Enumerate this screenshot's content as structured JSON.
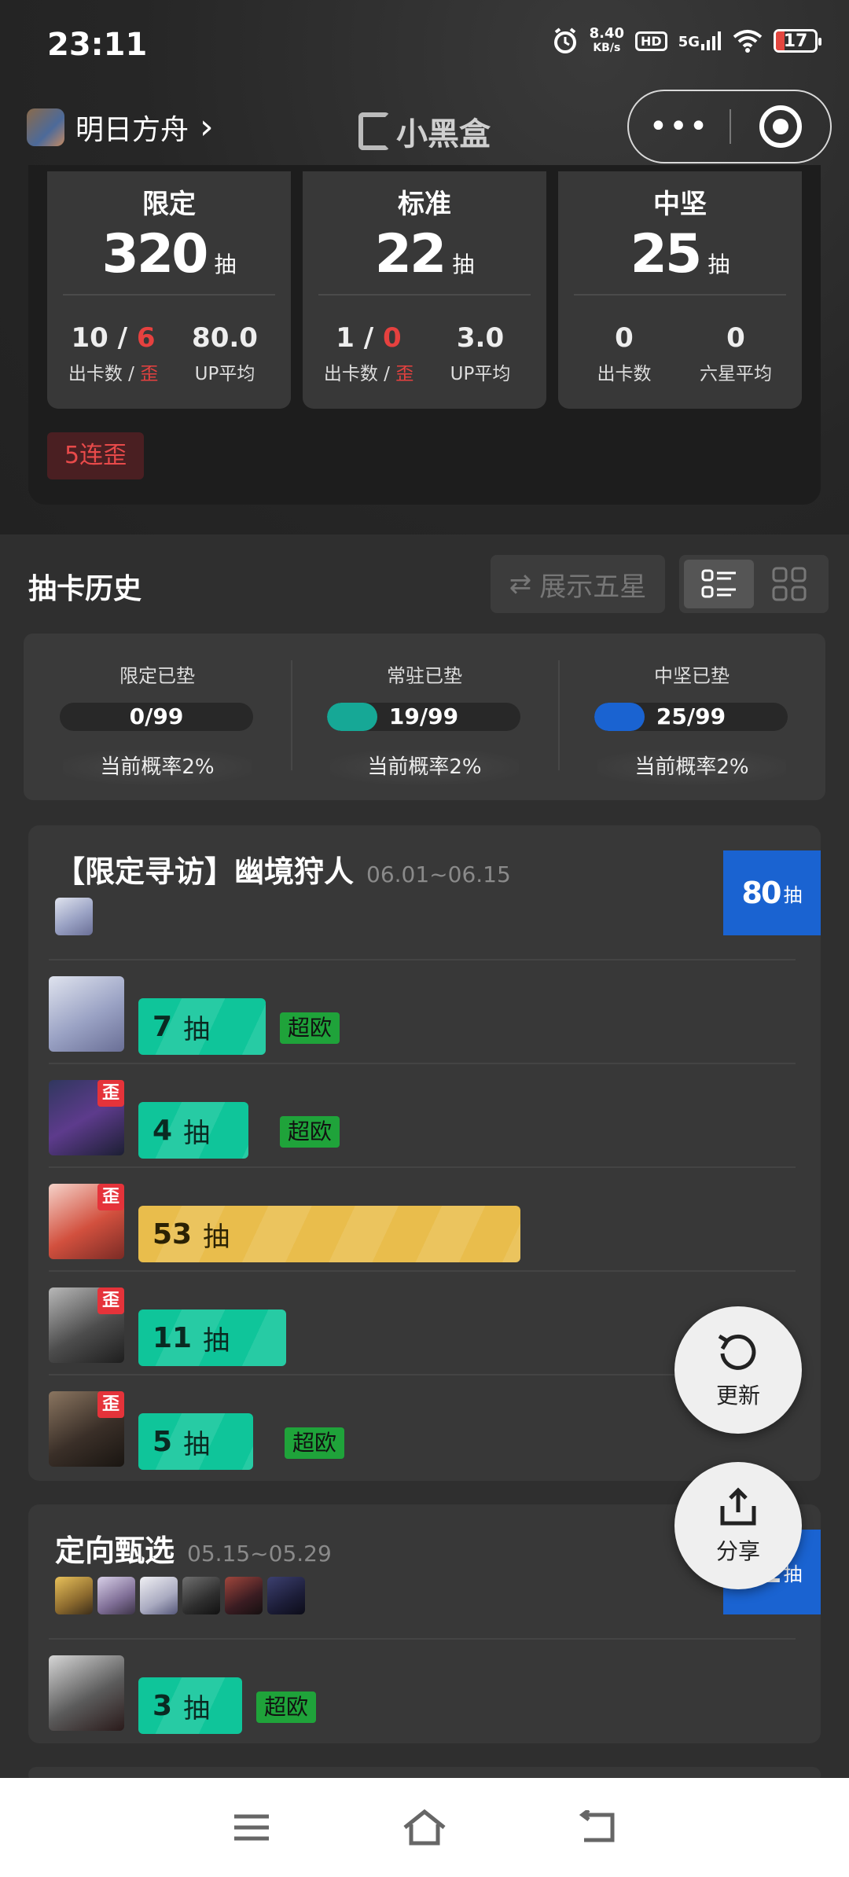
{
  "status_bar": {
    "time": "23:11",
    "speed_value": "8.40",
    "speed_unit": "KB/s",
    "hd": "HD",
    "network": "5G",
    "battery": "17"
  },
  "header": {
    "game_name": "明日方舟",
    "chevron": "›",
    "brand": "小黑盒",
    "menu_dots": "•••"
  },
  "stats": [
    {
      "title": "限定",
      "count": "320",
      "unit": "抽",
      "left_value_a": "10",
      "left_sep": " / ",
      "left_value_b": "6",
      "left_label_a": "出卡数 / ",
      "left_label_b": "歪",
      "right_value": "80.0",
      "right_label": "UP平均"
    },
    {
      "title": "标准",
      "count": "22",
      "unit": "抽",
      "left_value_a": "1",
      "left_sep": " / ",
      "left_value_b": "0",
      "left_label_a": "出卡数 / ",
      "left_label_b": "歪",
      "right_value": "3.0",
      "right_label": "UP平均"
    },
    {
      "title": "中坚",
      "count": "25",
      "unit": "抽",
      "left_value": "0",
      "left_label": "出卡数",
      "right_value": "0",
      "right_label": "六星平均"
    }
  ],
  "streak_tag": "5连歪",
  "history": {
    "title": "抽卡历史",
    "show_five_star": "展示五星",
    "swap_icon": "⇄"
  },
  "pity": [
    {
      "name": "限定已垫",
      "value": "0/99",
      "progress": 0,
      "rate": "当前概率2%",
      "color": "#888888"
    },
    {
      "name": "常驻已垫",
      "value": "19/99",
      "progress": 0.19,
      "rate": "当前概率2%",
      "color": "#16a896"
    },
    {
      "name": "中坚已垫",
      "value": "25/99",
      "progress": 0.25,
      "rate": "当前概率2%",
      "color": "#1a63d1"
    }
  ],
  "banners": [
    {
      "title": "【限定寻访】幽境狩人",
      "dates": "06.01~06.15",
      "total": "80",
      "total_unit": "抽",
      "pulls": [
        {
          "count": "7",
          "unit": "抽",
          "tag": "超欧",
          "off_banner": false
        },
        {
          "count": "4",
          "unit": "抽",
          "tag": "超欧",
          "off_banner": true
        },
        {
          "count": "53",
          "unit": "抽",
          "tag": "",
          "off_banner": true
        },
        {
          "count": "11",
          "unit": "抽",
          "tag": "",
          "off_banner": true
        },
        {
          "count": "5",
          "unit": "抽",
          "tag": "超欧",
          "off_banner": true
        }
      ]
    },
    {
      "title": "定向甄选",
      "dates": "05.15~05.29",
      "total": "21",
      "total_unit": "抽",
      "pulls": [
        {
          "count": "3",
          "unit": "抽",
          "tag": "超欧",
          "off_banner": false
        }
      ]
    }
  ],
  "wai_label": "歪",
  "fab": {
    "refresh": "更新",
    "share": "分享"
  },
  "colors": {
    "accent_blue": "#1a63d1",
    "green_bar": "#0fc59a",
    "gold_bar": "#e9bd4c",
    "red": "#e6413f",
    "tag_green": "#1fa33a"
  },
  "icons": [
    "alarm-icon",
    "wifi-icon",
    "signal-icon",
    "menu-dots-icon",
    "target-icon",
    "swap-icon",
    "list-view-icon",
    "grid-view-icon",
    "refresh-icon",
    "share-icon",
    "menu-icon",
    "home-icon",
    "back-icon"
  ]
}
